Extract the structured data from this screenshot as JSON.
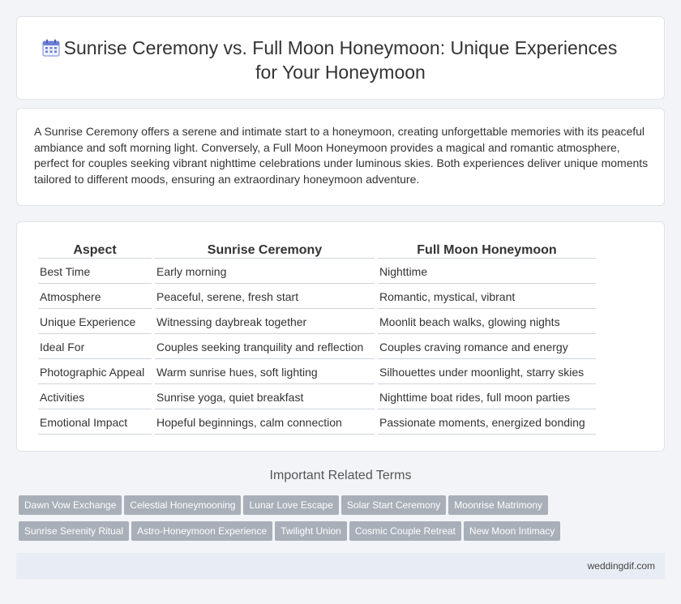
{
  "header": {
    "title_line1": "Sunrise Ceremony vs. Full Moon Honeymoon: Unique Experiences",
    "title_line2": "for Your Honeymoon",
    "icon": "calendar-icon"
  },
  "intro": {
    "text": "A Sunrise Ceremony offers a serene and intimate start to a honeymoon, creating unforgettable memories with its peaceful ambiance and soft morning light. Conversely, a Full Moon Honeymoon provides a magical and romantic atmosphere, perfect for couples seeking vibrant nighttime celebrations under luminous skies. Both experiences deliver unique moments tailored to different moods, ensuring an extraordinary honeymoon adventure."
  },
  "table": {
    "headers": [
      "Aspect",
      "Sunrise Ceremony",
      "Full Moon Honeymoon"
    ],
    "rows": [
      [
        "Best Time",
        "Early morning",
        "Nighttime"
      ],
      [
        "Atmosphere",
        "Peaceful, serene, fresh start",
        "Romantic, mystical, vibrant"
      ],
      [
        "Unique Experience",
        "Witnessing daybreak together",
        "Moonlit beach walks, glowing nights"
      ],
      [
        "Ideal For",
        "Couples seeking tranquility and reflection",
        "Couples craving romance and energy"
      ],
      [
        "Photographic Appeal",
        "Warm sunrise hues, soft lighting",
        "Silhouettes under moonlight, starry skies"
      ],
      [
        "Activities",
        "Sunrise yoga, quiet breakfast",
        "Nighttime boat rides, full moon parties"
      ],
      [
        "Emotional Impact",
        "Hopeful beginnings, calm connection",
        "Passionate moments, energized bonding"
      ]
    ]
  },
  "related": {
    "title": "Important Related Terms",
    "tags": [
      "Dawn Vow Exchange",
      "Celestial Honeymooning",
      "Lunar Love Escape",
      "Solar Start Ceremony",
      "Moonrise Matrimony",
      "Sunrise Serenity Ritual",
      "Astro-Honeymoon Experience",
      "Twilight Union",
      "Cosmic Couple Retreat",
      "New Moon Intimacy"
    ]
  },
  "footer": {
    "site": "weddingdif.com"
  },
  "colors": {
    "icon_accent": "#6b7fd7",
    "tag_bg": "#a8afb8",
    "footer_bg": "#e8edf5"
  }
}
